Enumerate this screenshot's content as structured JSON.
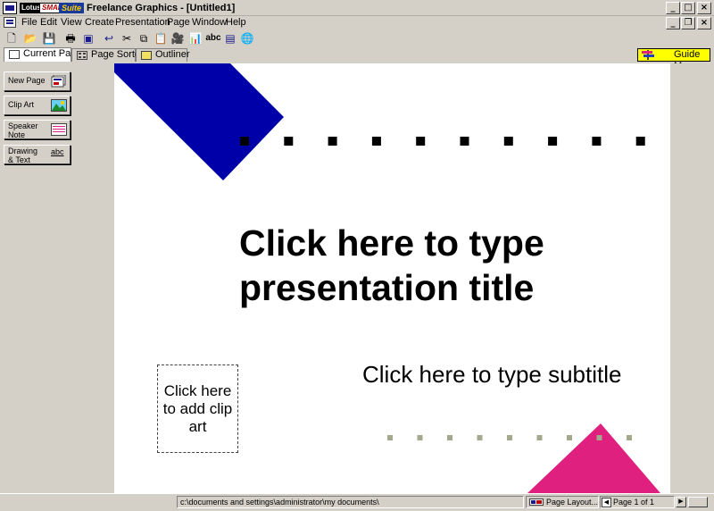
{
  "titlebar": {
    "brand": {
      "lotus": "Lotus",
      "smart": "SMART",
      "suite": "Suite"
    },
    "title": "Freelance Graphics - [Untitled1]",
    "controls": {
      "minimize": "_",
      "maximize": "□",
      "close": "×"
    }
  },
  "menubar": {
    "items": [
      "File",
      "Edit",
      "View",
      "Create",
      "Presentation",
      "Page",
      "Window",
      "Help"
    ],
    "doc_controls": {
      "minimize": "_",
      "restore": "❐",
      "close": "×"
    }
  },
  "toolbar": {
    "icons": {
      "new": "🗋",
      "open": "📂",
      "save": "💾",
      "print": "🖶",
      "screen_show": "▣",
      "undo": "↩",
      "cut": "✂",
      "copy": "⧉",
      "paste": "📋",
      "presenter": "🎥",
      "chart": "📊",
      "spell": "abc",
      "table": "▤",
      "internet": "🌐"
    }
  },
  "tabs": [
    "Current Page",
    "Page Sorter",
    "Outliner"
  ],
  "guide_me": {
    "label": "Guide Me"
  },
  "sidebar": {
    "buttons": [
      {
        "label": "New Page"
      },
      {
        "label": "Clip Art"
      },
      {
        "line1": "Speaker",
        "line2": "Note"
      },
      {
        "line1": "Drawing",
        "line2": "& Text",
        "icon_text": "abc"
      }
    ]
  },
  "slide": {
    "title": "Click here to type presentation title",
    "subtitle": "Click here to type subtitle",
    "clipart_placeholder": "Click here to add clip art",
    "colors": {
      "blue_shape": "#0000a8",
      "pink_shape": "#e0207e",
      "top_dots": "#000000",
      "bottom_dots": "#a4a88c"
    }
  },
  "statusbar": {
    "path": "c:\\documents and settings\\administrator\\my documents\\",
    "layout": "Page Layout...",
    "page": "Page 1 of 1",
    "prev_icon": "◀",
    "next_icon": "▶"
  }
}
